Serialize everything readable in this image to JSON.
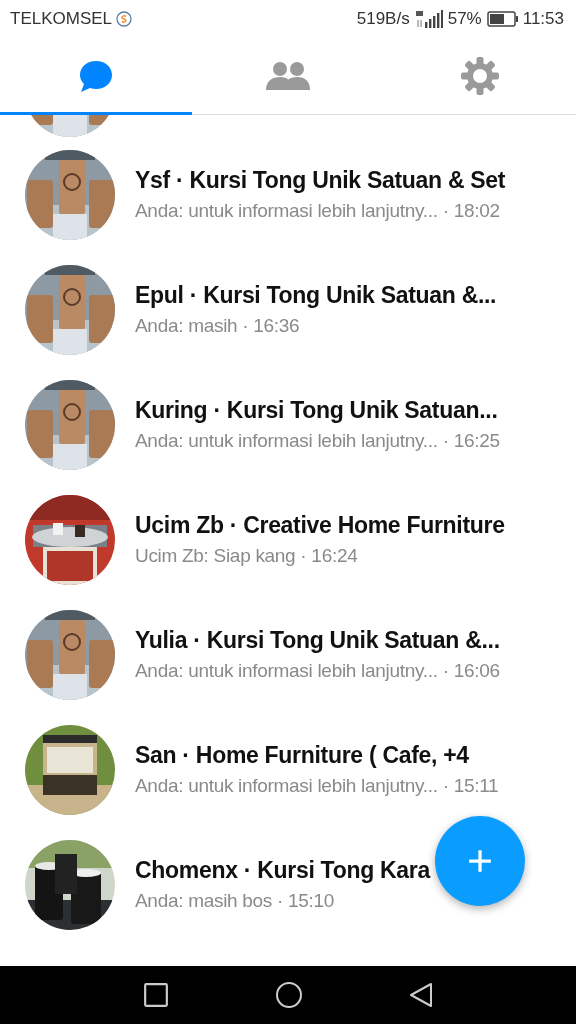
{
  "status_bar": {
    "carrier": "TELKOMSEL",
    "speed": "519B/s",
    "battery": "57%",
    "time": "11:53"
  },
  "tabs": [
    {
      "kind": "chats",
      "selected": true
    },
    {
      "kind": "people",
      "selected": false
    },
    {
      "kind": "settings",
      "selected": false
    }
  ],
  "conversations": [
    {
      "title": "Ysf · Kursi Tong Unik Satuan & Set",
      "snippet": "Anda: untuk informasi lebih lanjutny... · 18:02"
    },
    {
      "title": "Epul · Kursi Tong Unik Satuan &...",
      "snippet": "Anda: masih · 16:36"
    },
    {
      "title": "Kuring · Kursi Tong Unik Satuan...",
      "snippet": "Anda: untuk informasi lebih lanjutny... · 16:25"
    },
    {
      "title": "Ucim Zb · Creative Home Furniture",
      "snippet": "Ucim Zb: Siap kang · 16:24"
    },
    {
      "title": "Yulia · Kursi Tong Unik Satuan &...",
      "snippet": "Anda: untuk informasi lebih lanjutny... · 16:06"
    },
    {
      "title": "San · Home Furniture ( Cafe, +4",
      "snippet": "Anda: untuk informasi lebih lanjutny... · 15:11"
    },
    {
      "title": "Chomenx · Kursi Tong Kara",
      "snippet": "Anda: masih bos · 15:10"
    }
  ]
}
